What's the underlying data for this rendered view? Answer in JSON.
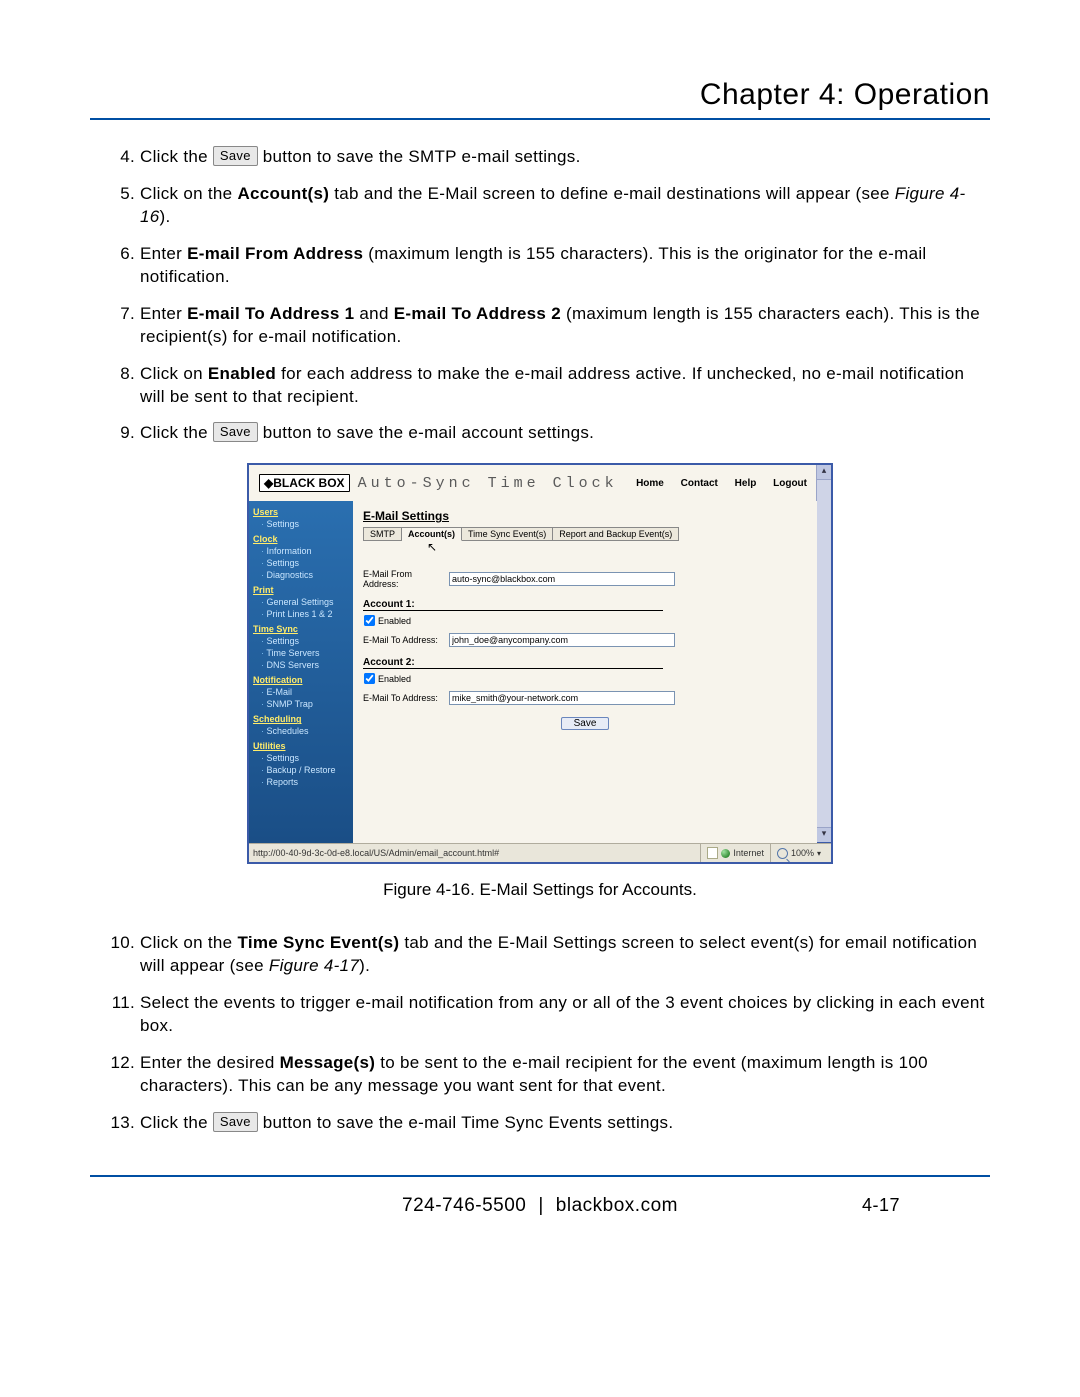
{
  "header": {
    "chapter_title": "Chapter 4: Operation"
  },
  "steps_a": [
    {
      "n": "4.",
      "pre": "Click the ",
      "btn": "Save",
      "post": " button to save the SMTP e-mail settings."
    },
    {
      "n": "5.",
      "text_a": "Click on the ",
      "bold": "Account(s)",
      "text_b": " tab and the E-Mail screen to define e-mail destinations will appear (see ",
      "italic": "Figure 4-16",
      "text_c": ")."
    },
    {
      "n": "6.",
      "text_a": "Enter ",
      "bold": "E-mail From Address",
      "text_b": " (maximum length is 155 characters). This is the originator for the e-mail notification."
    },
    {
      "n": "7.",
      "text_a": "Enter ",
      "bold": "E-mail To Address 1",
      "mid": " and ",
      "bold2": "E-mail To Address 2",
      "text_b": " (maximum length is 155 characters each). This is the recipient(s) for e-mail notification."
    },
    {
      "n": "8.",
      "text_a": "Click on ",
      "bold": "Enabled",
      "text_b": " for each address to make the e-mail address active. If unchecked, no e-mail notification will be sent to that recipient."
    },
    {
      "n": "9.",
      "pre": "Click the ",
      "btn": "Save",
      "post": " button to save the e-mail account settings."
    }
  ],
  "figure_caption": "Figure 4-16.  E-Mail Settings for Accounts.",
  "steps_b": [
    {
      "n": "10.",
      "text_a": "Click on the ",
      "bold": "Time Sync Event(s)",
      "text_b": " tab and the E-Mail Settings screen to select event(s) for email notification will appear (see ",
      "italic": "Figure 4-17",
      "text_c": ")."
    },
    {
      "n": "11.",
      "text": "Select the events to trigger e-mail notification from any or all of the 3 event choices by clicking in each event box."
    },
    {
      "n": "12.",
      "text_a": "Enter the desired ",
      "bold": "Message(s)",
      "text_b": " to be sent to the e-mail recipient for the event (maximum length is 100 characters). This can be any message you want sent for that event."
    },
    {
      "n": "13.",
      "pre": "Click the ",
      "btn": "Save",
      "post": " button to save the e-mail Time Sync Events settings."
    }
  ],
  "screenshot": {
    "logo_text": "◆BLACK BOX",
    "app_title": "Auto-Sync Time Clock",
    "topnav": [
      "Home",
      "Contact",
      "Help",
      "Logout"
    ],
    "sidebar": [
      {
        "section": "Users",
        "items": [
          "Settings"
        ]
      },
      {
        "section": "Clock",
        "items": [
          "Information",
          "Settings",
          "Diagnostics"
        ]
      },
      {
        "section": "Print",
        "items": [
          "General Settings",
          "Print Lines 1 & 2"
        ]
      },
      {
        "section": "Time Sync",
        "items": [
          "Settings",
          "Time Servers",
          "DNS Servers"
        ]
      },
      {
        "section": "Notification",
        "items": [
          "E-Mail",
          "SNMP Trap"
        ]
      },
      {
        "section": "Scheduling",
        "items": [
          "Schedules"
        ]
      },
      {
        "section": "Utilities",
        "items": [
          "Settings",
          "Backup / Restore",
          "Reports"
        ]
      }
    ],
    "main_heading": "E-Mail Settings",
    "tabs": [
      "SMTP",
      "Account(s)",
      "Time Sync Event(s)",
      "Report and Backup Event(s)"
    ],
    "active_tab": 1,
    "from_label": "E-Mail From Address:",
    "from_value": "auto-sync@blackbox.com",
    "account1_hdr": "Account 1:",
    "account2_hdr": "Account 2:",
    "enabled_label": "Enabled",
    "to_label": "E-Mail To Address:",
    "to_value_1": "john_doe@anycompany.com",
    "to_value_2": "mike_smith@your-network.com",
    "save_label": "Save",
    "statusbar": {
      "url": "http://00-40-9d-3c-0d-e8.local/US/Admin/email_account.html#",
      "zone": "Internet",
      "zoom": "100%"
    }
  },
  "footer": {
    "phone": "724-746-5500",
    "sep": "|",
    "site": "blackbox.com",
    "pageno": "4-17"
  }
}
